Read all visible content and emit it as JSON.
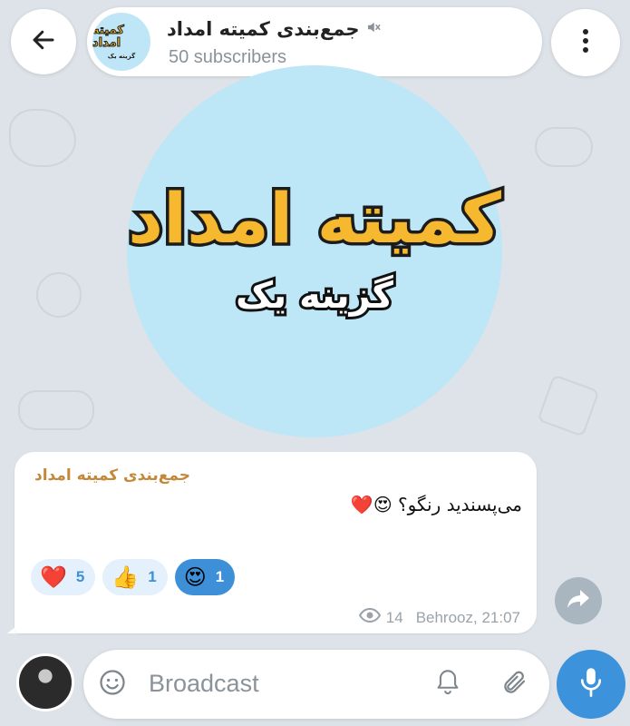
{
  "header": {
    "channel_title": "جمع‌بندی کمیته امداد",
    "subscribers": "50 subscribers",
    "avatar_text_main": "کمیته امداد",
    "avatar_text_sub": "گزینه یک",
    "back_icon": "arrow-left-icon",
    "mute_icon": "muted-speaker-icon",
    "menu_icon": "more-vertical-icon"
  },
  "big_avatar": {
    "title": "کمیته امداد",
    "subtitle": "گزینه یک"
  },
  "message": {
    "sender": "جمع‌بندی کمیته امداد",
    "text": "می‌پسندید رنگو؟ 😍❤️",
    "reactions": [
      {
        "emoji": "❤️",
        "count": "5",
        "active": false
      },
      {
        "emoji": "👍",
        "count": "1",
        "active": false
      },
      {
        "emoji": "😍",
        "count": "1",
        "active": true
      }
    ],
    "views": "14",
    "author_time": "Behrooz, 21:07",
    "share_icon": "share-arrow-icon"
  },
  "composer": {
    "placeholder": "Broadcast",
    "emoji_icon": "smiley-icon",
    "bell_icon": "bell-icon",
    "attach_icon": "paperclip-icon",
    "mic_icon": "microphone-icon"
  },
  "colors": {
    "accent": "#3d92dc",
    "sender_name": "#c4883a",
    "wallpaper": "#dde3e8",
    "avatar_bg": "#bde6f7",
    "logo_yellow": "#f5b82e"
  }
}
